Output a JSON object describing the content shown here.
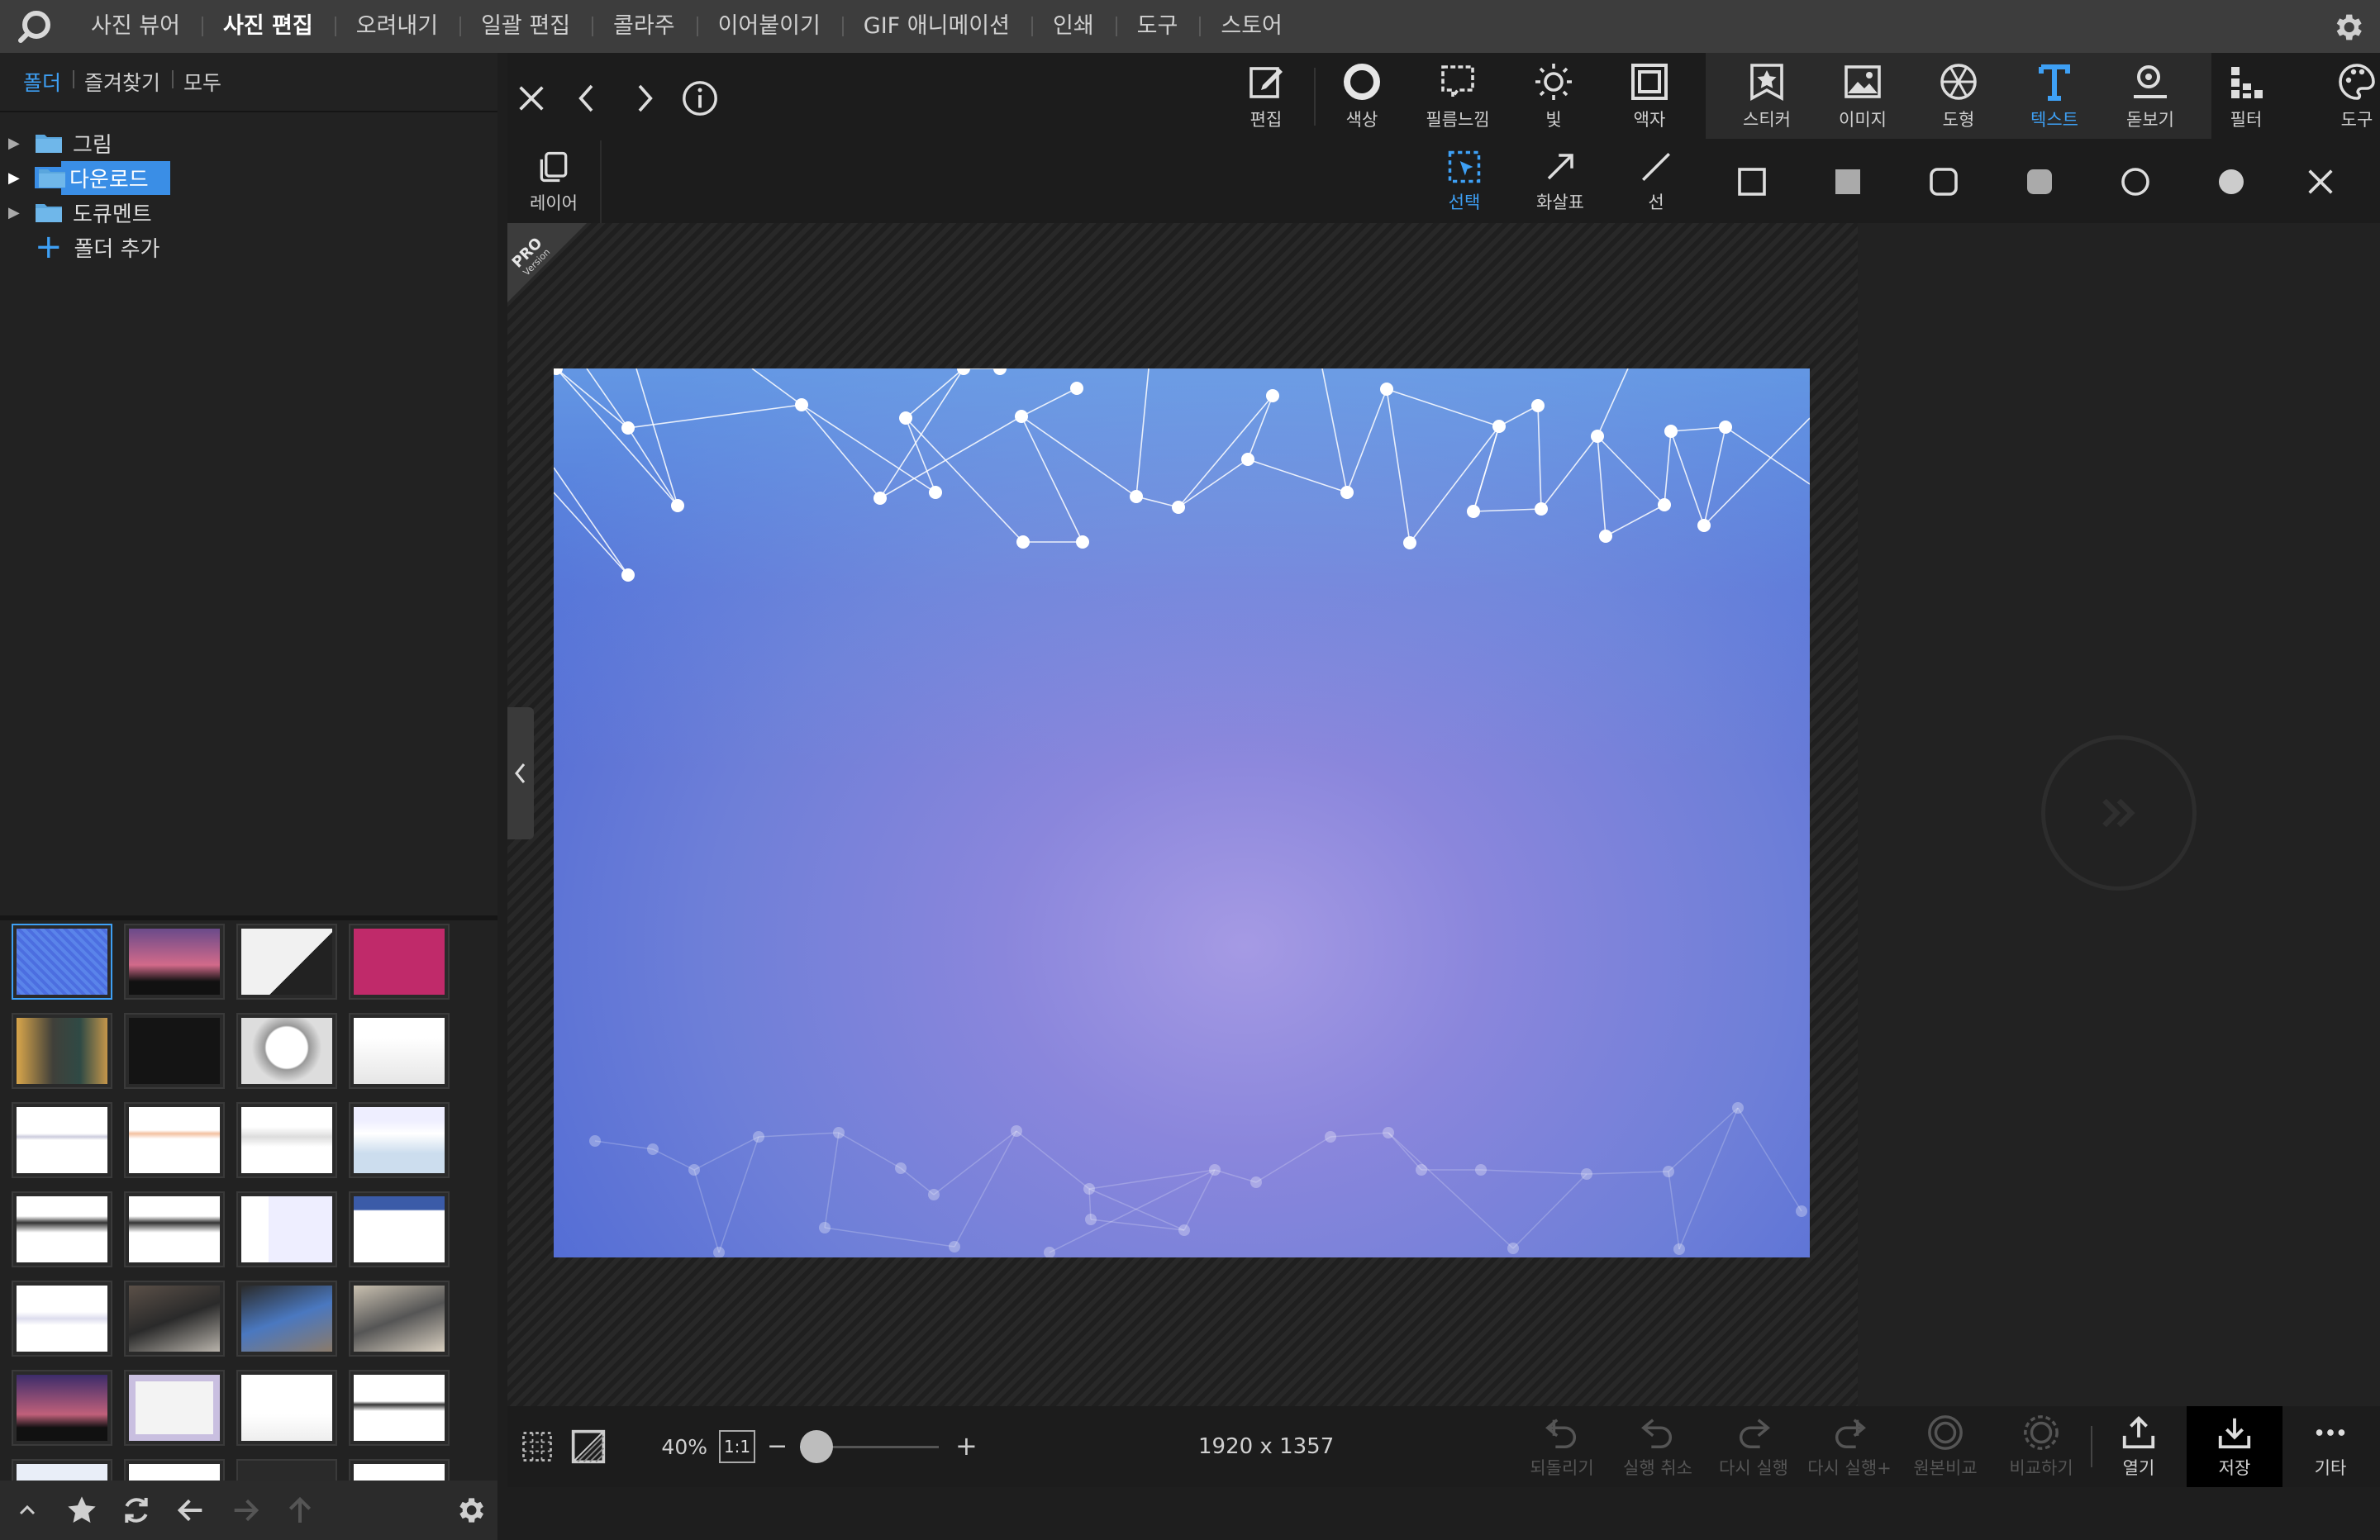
{
  "menu": {
    "items": [
      "사진 뷰어",
      "사진 편집",
      "오려내기",
      "일괄 편집",
      "콜라주",
      "이어붙이기",
      "GIF 애니메이션",
      "인쇄",
      "도구",
      "스토어"
    ],
    "active_index": 1
  },
  "sidebar": {
    "tabs": [
      "폴더",
      "즐겨찾기",
      "모두"
    ],
    "active_tab": "폴더",
    "tree": [
      {
        "label": "그림",
        "selected": false
      },
      {
        "label": "다운로드",
        "selected": true
      },
      {
        "label": "도큐멘트",
        "selected": false
      }
    ],
    "add_folder_label": "폴더 추가",
    "thumbnail_count": 28
  },
  "toolbar": {
    "tools": [
      {
        "label": "편집",
        "icon": "edit-icon"
      },
      {
        "label": "색상",
        "icon": "color-ring-icon"
      },
      {
        "label": "필름느낌",
        "icon": "film-icon"
      },
      {
        "label": "빛",
        "icon": "sun-icon"
      },
      {
        "label": "액자",
        "icon": "frame-icon"
      },
      {
        "label": "스티커",
        "icon": "sticker-icon"
      },
      {
        "label": "이미지",
        "icon": "image-icon"
      },
      {
        "label": "도형",
        "icon": "shape-icon"
      },
      {
        "label": "텍스트",
        "icon": "text-icon"
      },
      {
        "label": "돋보기",
        "icon": "magnifier-icon"
      },
      {
        "label": "필터",
        "icon": "filter-icon"
      },
      {
        "label": "도구",
        "icon": "palette-icon"
      }
    ],
    "active_tool": "텍스트"
  },
  "subtoolbar": {
    "layer_label": "레이어",
    "select_label": "선택",
    "arrow_label": "화살표",
    "line_label": "선"
  },
  "canvas": {
    "pro_badge_line1": "PRO",
    "pro_badge_line2": "Version"
  },
  "status": {
    "zoom_percent": "40%",
    "zoom_one_to_one": "1:1",
    "zoom_slider_fraction": 0.12,
    "dimensions": "1920 x 1357",
    "actions": [
      {
        "label": "되돌리기",
        "enabled": false
      },
      {
        "label": "실행 취소",
        "enabled": false
      },
      {
        "label": "다시 실행",
        "enabled": false
      },
      {
        "label": "다시 실행+",
        "enabled": false
      },
      {
        "label": "원본비교",
        "enabled": false
      },
      {
        "label": "비교하기",
        "enabled": false
      },
      {
        "label": "열기",
        "enabled": true
      },
      {
        "label": "저장",
        "enabled": true
      },
      {
        "label": "기타",
        "enabled": true
      }
    ]
  },
  "colors": {
    "accent": "#3ea0f5",
    "selection": "#3a8ee6",
    "topbar": "#3d3d3d",
    "panel": "#222222"
  }
}
